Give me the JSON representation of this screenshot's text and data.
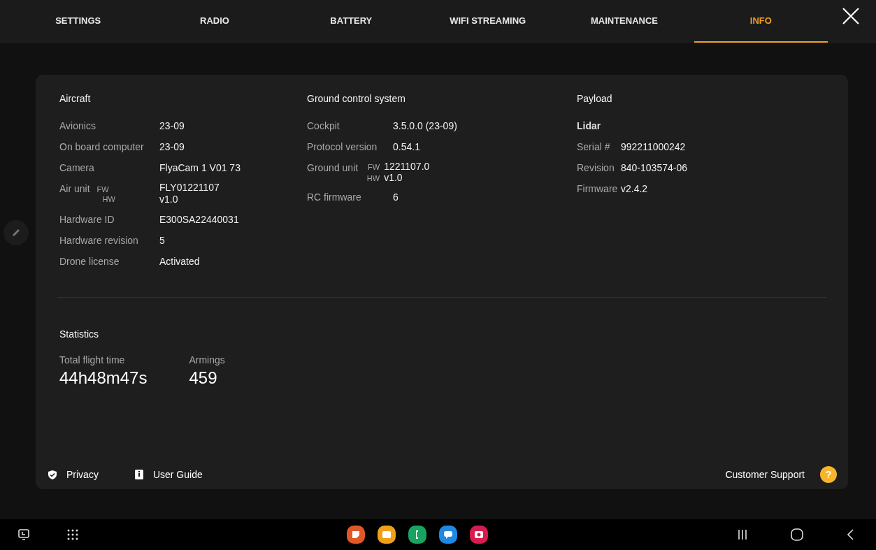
{
  "tabs": [
    {
      "label": "SETTINGS",
      "selected": false
    },
    {
      "label": "RADIO",
      "selected": false
    },
    {
      "label": "BATTERY",
      "selected": false
    },
    {
      "label": "WIFI STREAMING",
      "selected": false
    },
    {
      "label": "MAINTENANCE",
      "selected": false
    },
    {
      "label": "INFO",
      "selected": true
    }
  ],
  "sections": [
    {
      "title": "Aircraft",
      "rows": [
        {
          "kind": "plain",
          "label": "Avionics",
          "value": "23-09"
        },
        {
          "kind": "plain",
          "label": "On board computer",
          "value": "23-09"
        },
        {
          "kind": "plain",
          "label": "Camera",
          "value": "FlyaCam 1 V01 73"
        },
        {
          "kind": "dual",
          "label": "Air unit",
          "sub": [
            "FW",
            "HW"
          ],
          "values": [
            "FLY01221107",
            "v1.0"
          ]
        },
        {
          "kind": "plain",
          "label": "Hardware ID",
          "value": "E300SA22440031"
        },
        {
          "kind": "plain",
          "label": "Hardware revision",
          "value": "5"
        },
        {
          "kind": "plain",
          "label": "Drone license",
          "value": "Activated"
        }
      ]
    },
    {
      "title": "Ground control system",
      "rows": [
        {
          "kind": "plain",
          "label": "Cockpit",
          "value": "3.5.0.0 (23-09)"
        },
        {
          "kind": "plain",
          "label": "Protocol version",
          "value": "0.54.1"
        },
        {
          "kind": "inline",
          "label": "Ground unit",
          "sub": [
            "FW",
            "HW"
          ],
          "values": [
            "1221107.0",
            "v1.0"
          ]
        },
        {
          "kind": "plain",
          "label": "RC firmware",
          "value": "6"
        }
      ]
    },
    {
      "title": "Payload",
      "rows": [
        {
          "kind": "heading",
          "label": "Lidar"
        },
        {
          "kind": "plain",
          "label": "Serial #",
          "value": "992211000242"
        },
        {
          "kind": "plain",
          "label": "Revision",
          "value": "840-103574-06"
        },
        {
          "kind": "plain",
          "label": "Firmware",
          "value": "v2.4.2"
        }
      ]
    }
  ],
  "statistics": {
    "title": "Statistics",
    "items": [
      {
        "label": "Total flight time",
        "value": "44h48m47s"
      },
      {
        "label": "Armings",
        "value": "459"
      }
    ]
  },
  "footer": {
    "links": [
      {
        "kind": "privacy",
        "label": "Privacy"
      },
      {
        "kind": "guide",
        "label": "User Guide"
      }
    ],
    "support": "Customer Support",
    "help": "?"
  }
}
